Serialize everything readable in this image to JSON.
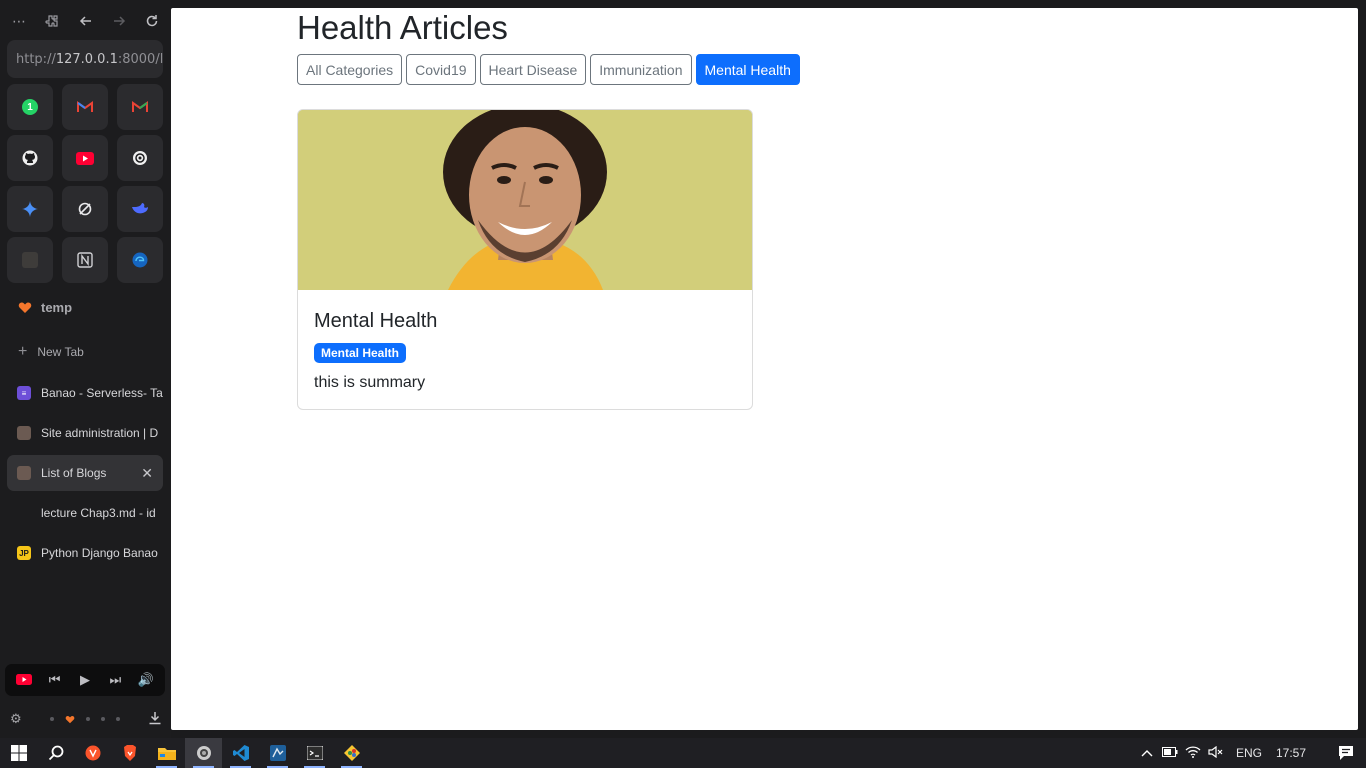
{
  "browser": {
    "url_scheme": "http://",
    "url_host": "127.0.0.1",
    "url_rest": ":8000/l",
    "space_name": "temp",
    "new_tab_label": "New Tab",
    "tabs": [
      {
        "label": "Banao - Serverless- Ta",
        "color": "#6d4fd8",
        "icon": "list-icon"
      },
      {
        "label": "Site administration | D",
        "color": "#6b5a52",
        "icon": "site-icon"
      },
      {
        "label": "List of Blogs",
        "color": "#6b5a52",
        "icon": "site-icon"
      },
      {
        "label": "lecture Chap3.md - id",
        "color": "#1c1c1e",
        "icon": "doc-icon"
      },
      {
        "label": "Python Django Banao",
        "color": "#f5c518",
        "icon": "jp-icon",
        "badge": "JP"
      }
    ],
    "pins": [
      "whatsapp-icon",
      "gmail-icon",
      "gmail-icon",
      "github-icon",
      "youtube-icon",
      "chatgpt-icon",
      "gemini-icon",
      "perplexity-icon",
      "deepseek-icon",
      "blank-icon",
      "notion-icon",
      "edge-icon"
    ],
    "whatsapp_badge": "1"
  },
  "page": {
    "title": "Health Articles",
    "filters": [
      "All Categories",
      "Covid19",
      "Heart Disease",
      "Immunization",
      "Mental Health"
    ],
    "active_filter": "Mental Health",
    "card": {
      "title": "Mental Health",
      "badge": "Mental Health",
      "summary": "this is summary"
    }
  },
  "taskbar": {
    "lang": "ENG",
    "time": "17:57"
  }
}
